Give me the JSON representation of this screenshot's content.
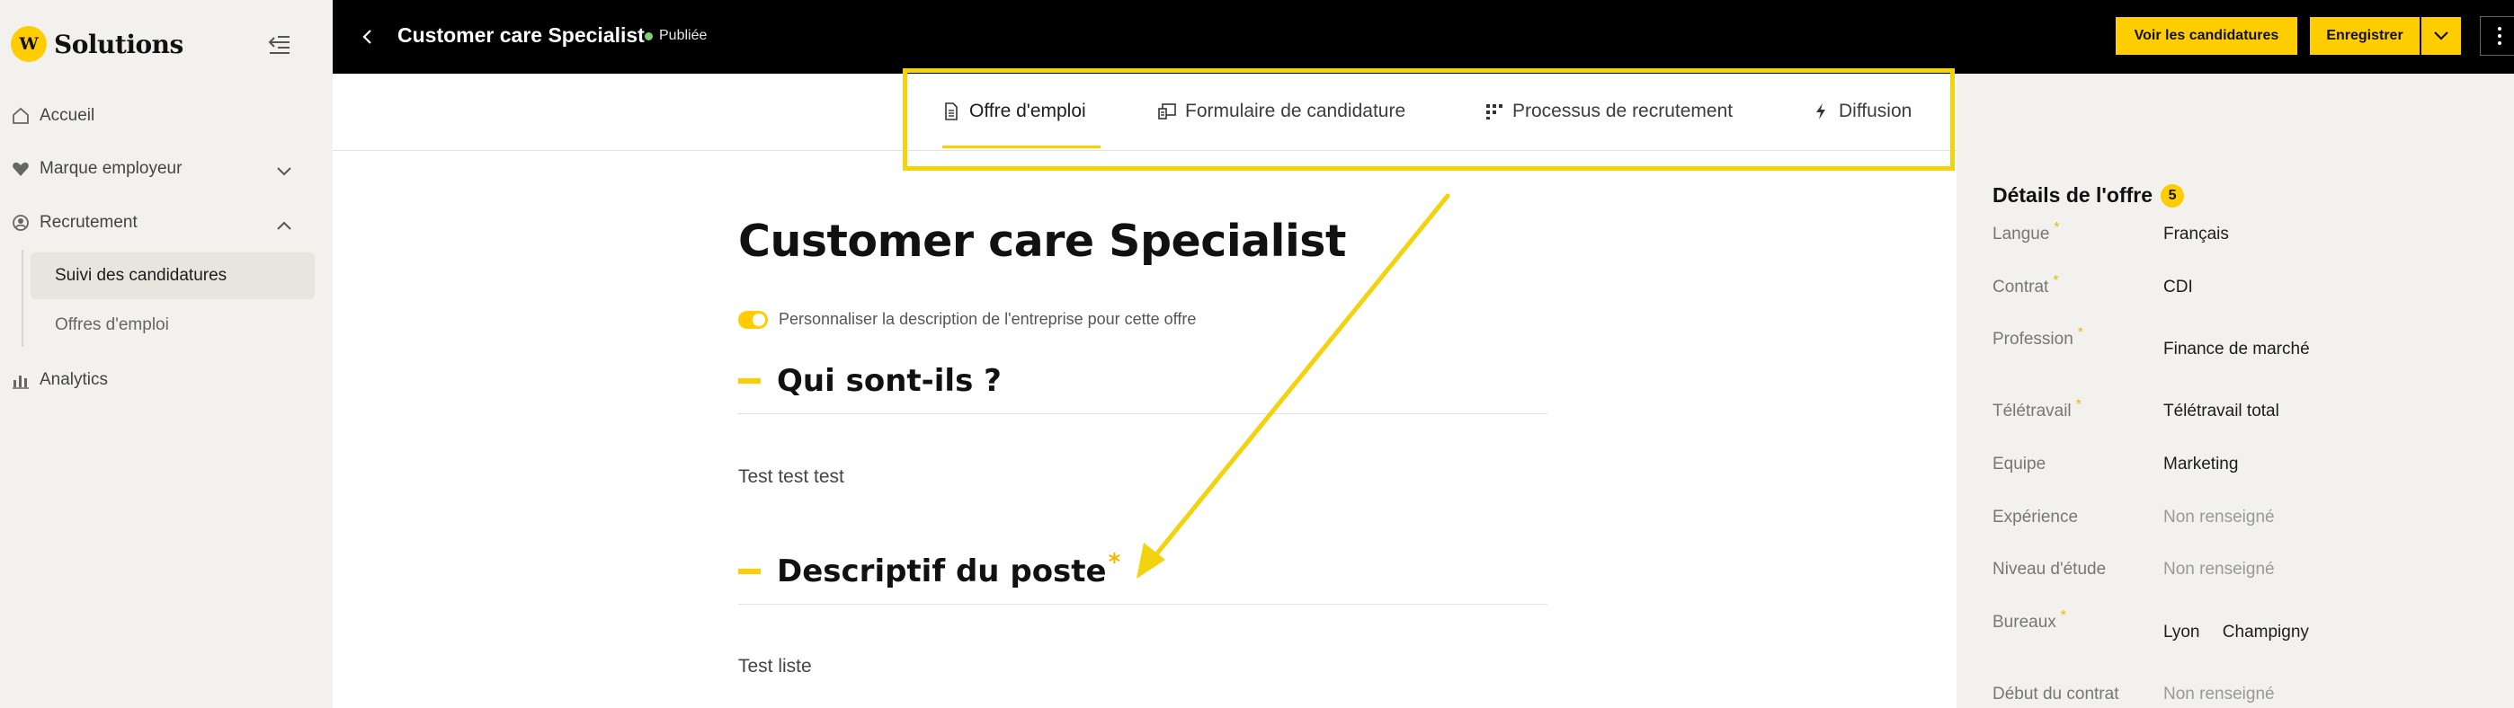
{
  "brand": {
    "name": "Solutions",
    "badge": "W"
  },
  "sidebar": {
    "items": [
      {
        "label": "Accueil",
        "icon": "home-icon"
      },
      {
        "label": "Marque employeur",
        "icon": "heart-icon"
      },
      {
        "label": "Recrutement",
        "icon": "recruitment-icon"
      },
      {
        "label": "Analytics",
        "icon": "chart-icon"
      }
    ],
    "subitems": [
      {
        "label": "Suivi des candidatures",
        "active": true
      },
      {
        "label": "Offres d'emploi",
        "active": false
      }
    ]
  },
  "header": {
    "title": "Customer care Specialist",
    "status": "Publiée",
    "view_applications_label": "Voir les candidatures",
    "save_label": "Enregistrer"
  },
  "tabs": [
    {
      "label": "Offre d'emploi",
      "icon": "document-icon",
      "active": true
    },
    {
      "label": "Formulaire de candidature",
      "icon": "form-icon",
      "active": false
    },
    {
      "label": "Processus de recrutement",
      "icon": "process-icon",
      "active": false
    },
    {
      "label": "Diffusion",
      "icon": "lightning-icon",
      "active": false
    }
  ],
  "main": {
    "heading": "Customer care Specialist",
    "toggle_label": "Personnaliser la description de l'entreprise pour cette offre",
    "sections": [
      {
        "title": "Qui sont-ils ?",
        "text": "Test test test",
        "required": false
      },
      {
        "title": "Descriptif du poste",
        "text": "Test liste",
        "required": true
      }
    ]
  },
  "details": {
    "title": "Détails de l'offre",
    "count": "5",
    "rows": [
      {
        "label": "Langue",
        "value": "Français",
        "required": true
      },
      {
        "label": "Contrat",
        "value": "CDI",
        "required": true
      },
      {
        "label": "Profession",
        "value": "Finance de marché",
        "required": true
      },
      {
        "label": "Télétravail",
        "value": "Télétravail total",
        "required": true
      },
      {
        "label": "Equipe",
        "value": "Marketing",
        "required": false
      },
      {
        "label": "Expérience",
        "value": "Non renseigné",
        "required": false
      },
      {
        "label": "Niveau d'étude",
        "value": "Non renseigné",
        "required": false
      },
      {
        "label": "Bureaux",
        "values": [
          "Lyon",
          "Champigny"
        ],
        "required": true
      },
      {
        "label": "Début du contrat",
        "value": "Non renseigné",
        "required": false
      }
    ]
  },
  "colors": {
    "accent": "#ffcd00",
    "topbar": "#000000",
    "annotation": "#f3d20e",
    "status_dot": "#7dd36b"
  }
}
